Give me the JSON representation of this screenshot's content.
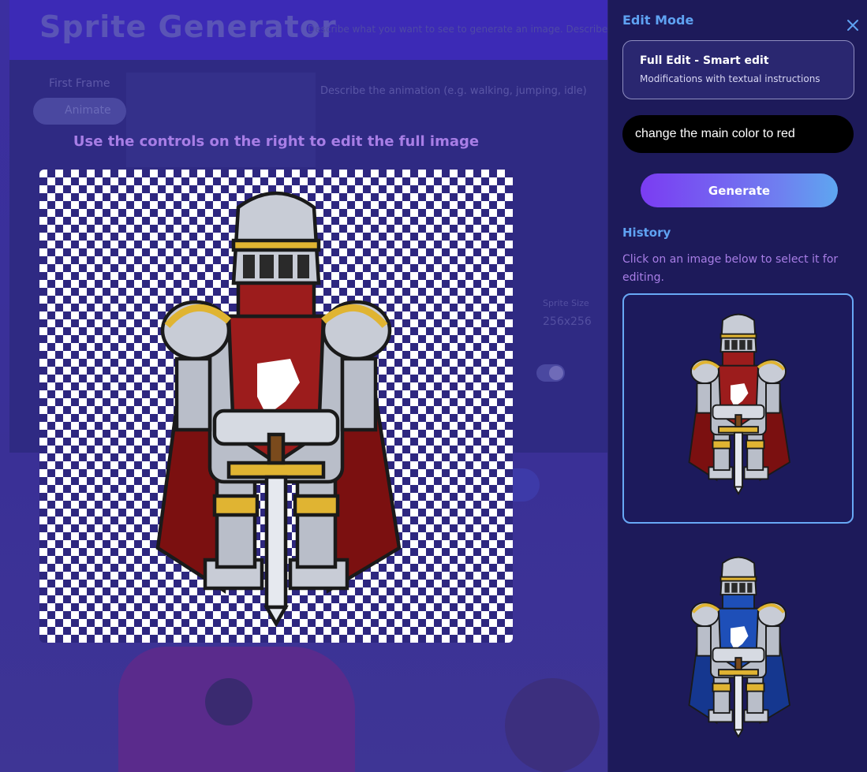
{
  "background": {
    "title": "Sprite Generator",
    "subtitle": "Describe what you want to see to generate an image. Describe a s",
    "tab_first_frame": "First Frame",
    "tab_animate": "Animate",
    "prompt_placeholder": "Describe the animation (e.g. walking, jumping, idle)",
    "sprite_size_label": "Sprite Size",
    "sprite_size_value": "256x256"
  },
  "canvas": {
    "hint": "Use the controls on the right to edit the full image"
  },
  "panel": {
    "title": "Edit Mode",
    "mode_title": "Full Edit - Smart edit",
    "mode_description": "Modifications with textual instructions",
    "instruction_value": "change the main color to red",
    "generate_label": "Generate",
    "history_title": "History",
    "history_hint": "Click on an image below to select it for editing.",
    "history": [
      {
        "tabard_color": "#9c1c1c",
        "cape_color": "#7b1010",
        "selected": true
      },
      {
        "tabard_color": "#1e4fb8",
        "cape_color": "#15378f",
        "selected": false
      }
    ]
  },
  "colors": {
    "accent_blue": "#5fa2f2",
    "accent_purple": "#a87ee6",
    "red_tabard": "#9c1c1c",
    "blue_tabard": "#1e4fb8"
  }
}
